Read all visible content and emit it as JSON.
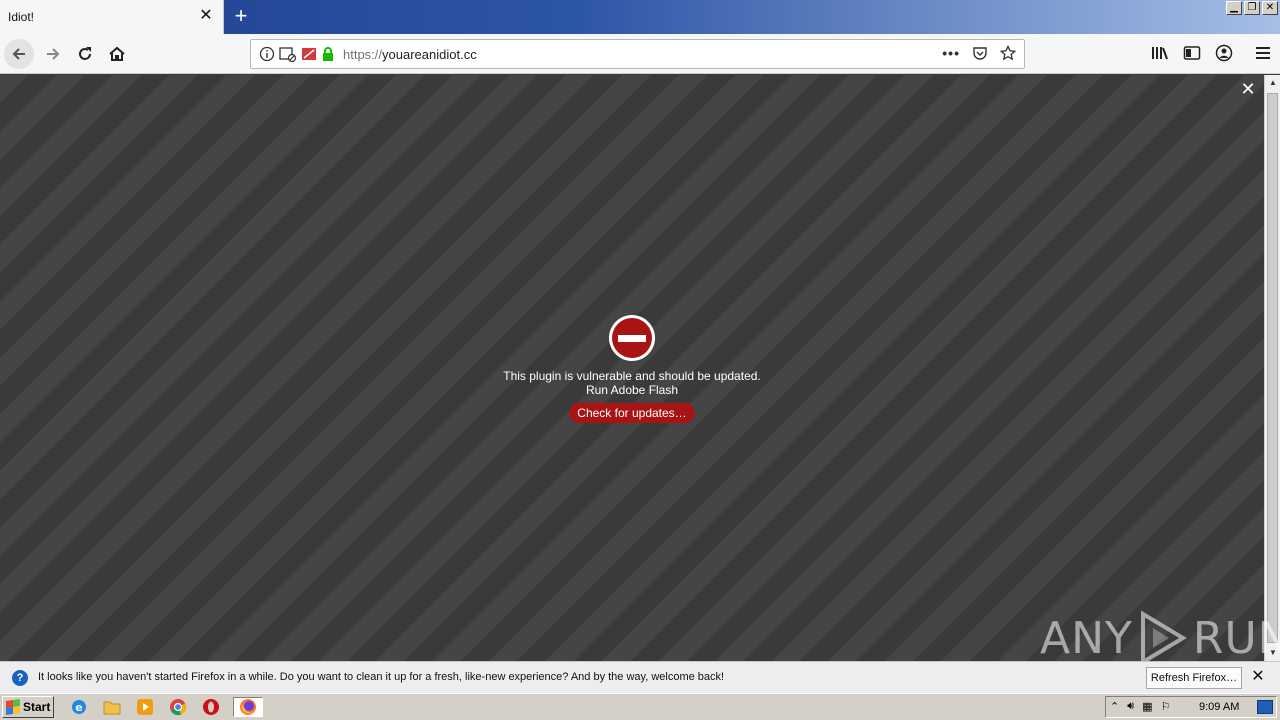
{
  "browser": {
    "tab": {
      "title": "Idiot!"
    },
    "url": {
      "scheme": "https://",
      "host": "youareanidiot.cc"
    },
    "window_controls": [
      "minimize",
      "restore",
      "close"
    ]
  },
  "content": {
    "plugin_message_line1": "This plugin is vulnerable and should be updated.",
    "plugin_message_line2": "Run Adobe Flash",
    "update_button": "Check for updates…",
    "watermark": "ANY",
    "watermark_run": "RUN"
  },
  "notification": {
    "text": "It looks like you haven't started Firefox in a while. Do you want to clean it up for a fresh, like-new experience? And by the way, welcome back!",
    "button": "Refresh Firefox…"
  },
  "taskbar": {
    "start_label": "Start",
    "clock": "9:09 AM"
  },
  "colors": {
    "block_red": "#a81414",
    "titlebar_blue": "#2d55a6"
  }
}
